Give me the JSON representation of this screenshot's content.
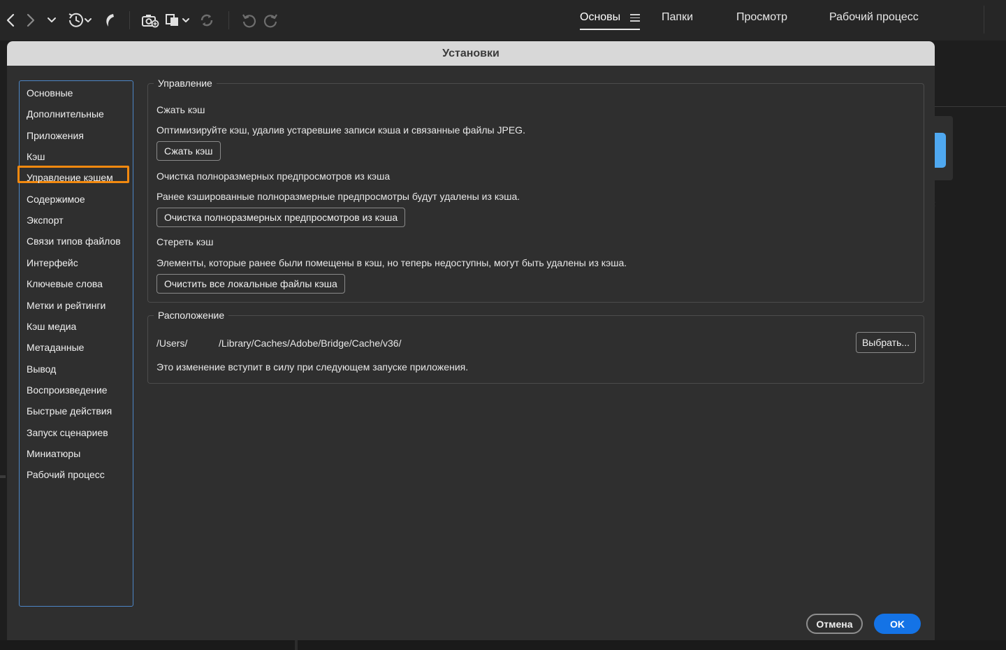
{
  "toolbar": {
    "icons": [
      "back-icon",
      "forward-icon",
      "recent-dropdown-icon",
      "history-icon",
      "boomerang-icon",
      "camera-import-icon",
      "copy-to-icon",
      "refresh-icon",
      "undo-icon",
      "redo-icon"
    ]
  },
  "workspaces": {
    "tabs": [
      {
        "label": "Основы",
        "active": true
      },
      {
        "label": "Папки",
        "active": false
      },
      {
        "label": "Просмотр",
        "active": false
      },
      {
        "label": "Рабочий процесс",
        "active": false
      }
    ]
  },
  "dialog": {
    "title": "Установки",
    "nav": {
      "selected_index": 4,
      "items": [
        "Основные",
        "Дополнительные",
        "Приложения",
        "Кэш",
        "Управление кэшем",
        "Содержимое",
        "Экспорт",
        "Связи типов файлов",
        "Интерфейс",
        "Ключевые слова",
        "Метки и рейтинги",
        "Кэш медиа",
        "Метаданные",
        "Вывод",
        "Воспроизведение",
        "Быстрые действия",
        "Запуск сценариев",
        "Миниатюры",
        "Рабочий процесс"
      ]
    },
    "management": {
      "legend": "Управление",
      "compact": {
        "heading": "Сжать кэш",
        "description": "Оптимизируйте кэш, удалив устаревшие записи кэша и связанные файлы JPEG.",
        "button": "Сжать кэш"
      },
      "purge_previews": {
        "heading": "Очистка полноразмерных предпросмотров из кэша",
        "description": "Ранее кэшированные полноразмерные предпросмотры будут удалены из кэша.",
        "button": "Очистка полноразмерных предпросмотров из кэша"
      },
      "purge_cache": {
        "heading": "Стереть кэш",
        "description": "Элементы, которые ранее были помещены в кэш, но теперь недоступны, могут быть удалены из кэша.",
        "button": "Очистить все локальные файлы кэша"
      }
    },
    "location": {
      "legend": "Расположение",
      "path_prefix": "/Users/",
      "path_suffix": "/Library/Caches/Adobe/Bridge/Cache/v36/",
      "choose_button": "Выбрать...",
      "note": "Это изменение вступит в силу при следующем запуске приложения."
    },
    "cancel_button": "Отмена",
    "ok_button": "OK"
  },
  "colors": {
    "accent": "#1473e6",
    "highlight": "#f2890f",
    "nav_border": "#4d86c6",
    "dialog_bg": "#2f2f2f"
  }
}
